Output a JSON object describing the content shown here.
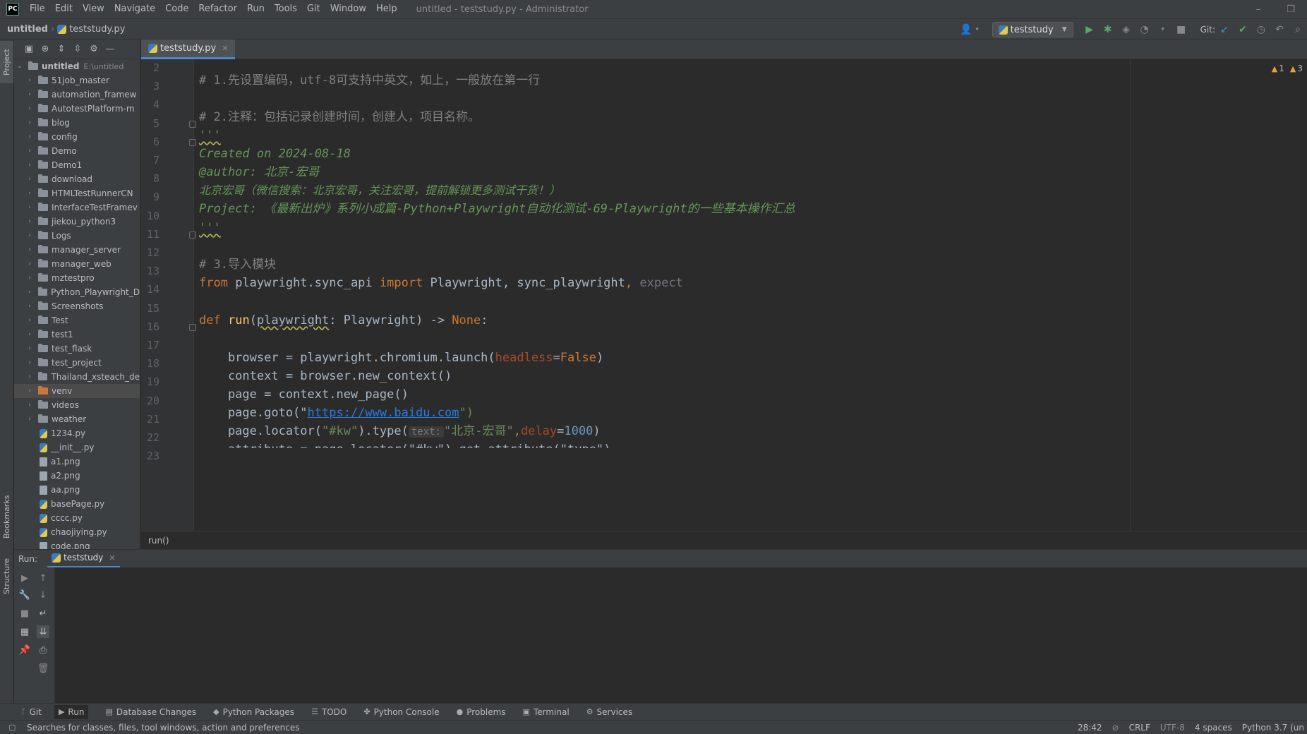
{
  "app": {
    "logo_text": "PC",
    "window_title": "untitled - teststudy.py - Administrator"
  },
  "menu": [
    "File",
    "Edit",
    "View",
    "Navigate",
    "Code",
    "Refactor",
    "Run",
    "Tools",
    "Git",
    "Window",
    "Help"
  ],
  "nav": {
    "project": "untitled",
    "file": "teststudy.py",
    "run_config": "teststudy",
    "git_label": "Git:"
  },
  "left_strip": {
    "project": "Project",
    "bookmarks": "Bookmarks",
    "structure": "Structure"
  },
  "tree": {
    "root": {
      "name": "untitled",
      "path": "E:\\untitled"
    },
    "folders": [
      "51job_master",
      "automation_framew",
      "AutotestPlatform-m",
      "blog",
      "config",
      "Demo",
      "Demo1",
      "download",
      "HTMLTestRunnerCN",
      "InterfaceTestFramev",
      "jiekou_python3",
      "Logs",
      "manager_server",
      "manager_web",
      "mztestpro",
      "Python_Playwright_D",
      "Screenshots",
      "Test",
      "test1",
      "test_flask",
      "test_project",
      "Thailand_xsteach_de",
      "venv",
      "videos",
      "weather"
    ],
    "files": [
      "1234.py",
      "__init__.py",
      "a1.png",
      "a2.png",
      "aa.png",
      "basePage.py",
      "cccc.py",
      "chaojiying.py",
      "code.png"
    ]
  },
  "editor": {
    "tab": "teststudy.py",
    "line_numbers": [
      "2",
      "3",
      "4",
      "5",
      "6",
      "7",
      "8",
      "9",
      "10",
      "11",
      "12",
      "13",
      "14",
      "15",
      "16",
      "17",
      "18",
      "19",
      "20",
      "21",
      "22",
      "23"
    ],
    "lines": {
      "l3": "# 1.先设置编码，utf-8可支持中英文，如上，一般放在第一行",
      "l5": "# 2.注释：包括记录创建时间，创建人，项目名称。",
      "l6": "'''",
      "l7": "Created on 2024-08-18",
      "l8": "@author: 北京-宏哥",
      "l9": "北京宏哥（微信搜索：北京宏哥，关注宏哥，提前解锁更多测试干货！）",
      "l10": "Project: 《最新出炉》系列小成篇-Python+Playwright自动化测试-69-Playwright的一些基本操作汇总",
      "l11": "'''",
      "l13": "# 3.导入模块",
      "l14_from": "from",
      "l14_mod": " playwright.sync_api ",
      "l14_import": "import",
      "l14_names": " Playwright, sync_playwright",
      "l14_comma": ", ",
      "l14_unused": "expect",
      "l16_def": "def",
      "l16_sp": " ",
      "l16_fn": "run",
      "l16_open": "(",
      "l16_param": "playwright",
      "l16_rest": ": Playwright) -> ",
      "l16_none": "None",
      "l16_colon": ":",
      "l18_a": "    browser = playwright.chromium.launch(",
      "l18_param": "headless",
      "l18_eq": "=",
      "l18_val": "False",
      "l18_close": ")",
      "l19": "    context = browser.new_context()",
      "l20": "    page = context.new_page()",
      "l21_a": "    page.goto(\"",
      "l21_url": "https://www.baidu.com",
      "l21_b": "\")",
      "l22_a": "    page.locator(",
      "l22_str1": "\"#kw\"",
      "l22_b": ").type(",
      "l22_hint": "text:",
      "l22_str2": "\"北京-宏哥\"",
      "l22_comma": ",",
      "l22_param": "delay",
      "l22_eq": "=",
      "l22_num": "1000",
      "l22_close": ")",
      "l23": "    attribute = page.locator(\"#kw\").get_attribute(\"type\")"
    },
    "warnings": {
      "count1": "1",
      "count2": "3"
    },
    "breadcrumb": "run()"
  },
  "run": {
    "label": "Run:",
    "tab": "teststudy"
  },
  "bottom_tools": [
    "Git",
    "Run",
    "Database Changes",
    "Python Packages",
    "TODO",
    "Python Console",
    "Problems",
    "Terminal",
    "Services"
  ],
  "status": {
    "message": "Searches for classes, files, tool windows, action and preferences",
    "position": "28:42",
    "line_sep": "CRLF",
    "encoding": "UTF-8",
    "indent": "4 spaces",
    "interpreter": "Python 3.7 (un"
  },
  "colors": {
    "accent": "#4a88c7",
    "run_green": "#59a869",
    "warning": "#e0a33f"
  }
}
